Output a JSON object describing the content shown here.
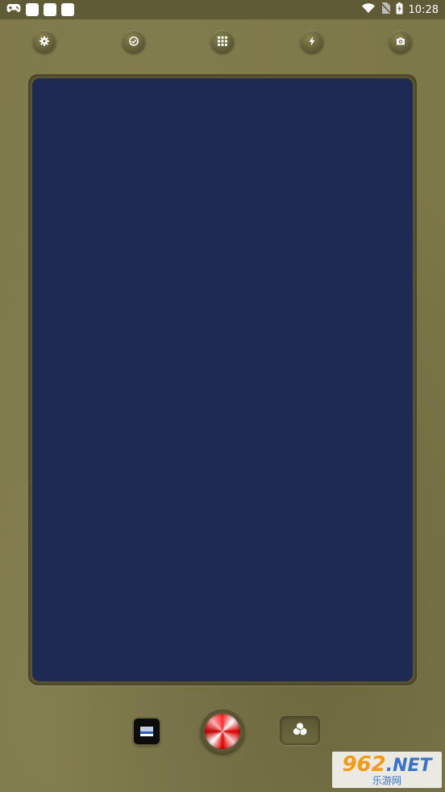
{
  "status_bar": {
    "time": "10:28",
    "icons": [
      "gamepad-icon",
      "notification-icon",
      "notification-icon",
      "notification-icon",
      "wifi-icon",
      "no-sim-icon",
      "battery-icon"
    ]
  },
  "toolbar": {
    "buttons": [
      "settings-icon",
      "timer-icon",
      "grid-icon",
      "flash-icon",
      "switch-camera-icon"
    ]
  },
  "viewfinder": {
    "color": "#1f2a52"
  },
  "bottom": {
    "gallery": "gallery-thumbnail",
    "shutter": "shutter-button",
    "filter": "filter-icon"
  },
  "watermark": {
    "number": "962",
    "domain": ".NET",
    "subtitle": "乐游网"
  }
}
